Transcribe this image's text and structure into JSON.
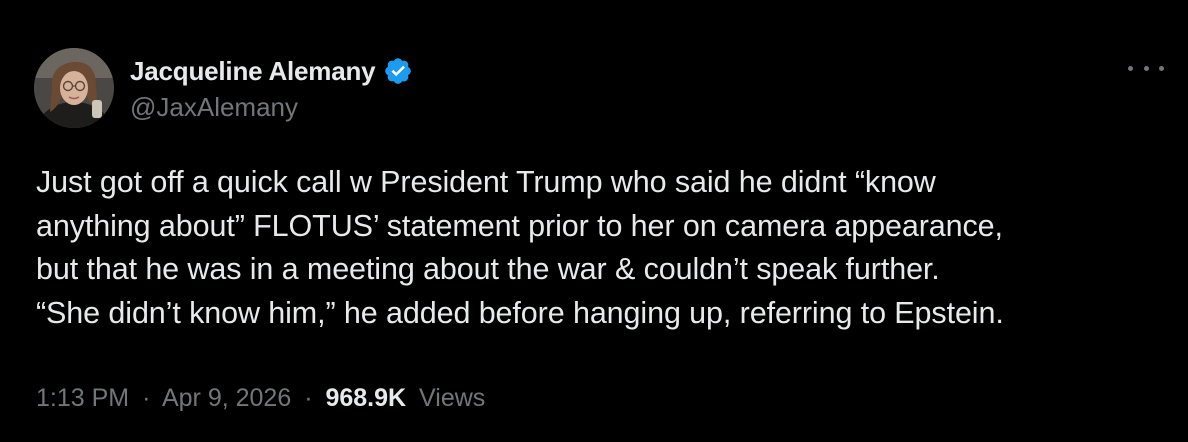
{
  "author": {
    "display_name": "Jacqueline Alemany",
    "handle": "@JaxAlemany",
    "verified_color": "#1d9bf0"
  },
  "tweet": {
    "text_lines": [
      "Just got off a quick call w President Trump who said he didnt “know",
      "anything about” FLOTUS’ statement prior to her on camera appearance,",
      "but that he was in a meeting about the war & couldn’t speak further.",
      "“She didn’t know him,” he added before hanging up, referring to Epstein."
    ]
  },
  "meta": {
    "time": "1:13 PM",
    "separator": "·",
    "date": "Apr 9, 2026",
    "views_count": "968.9K",
    "views_label": "Views"
  },
  "icons": {
    "more": "more-horizontal-icon",
    "verified": "verified-badge-icon"
  },
  "colors": {
    "background": "#000000",
    "primary_text": "#e7e9ea",
    "secondary_text": "#71767b"
  }
}
